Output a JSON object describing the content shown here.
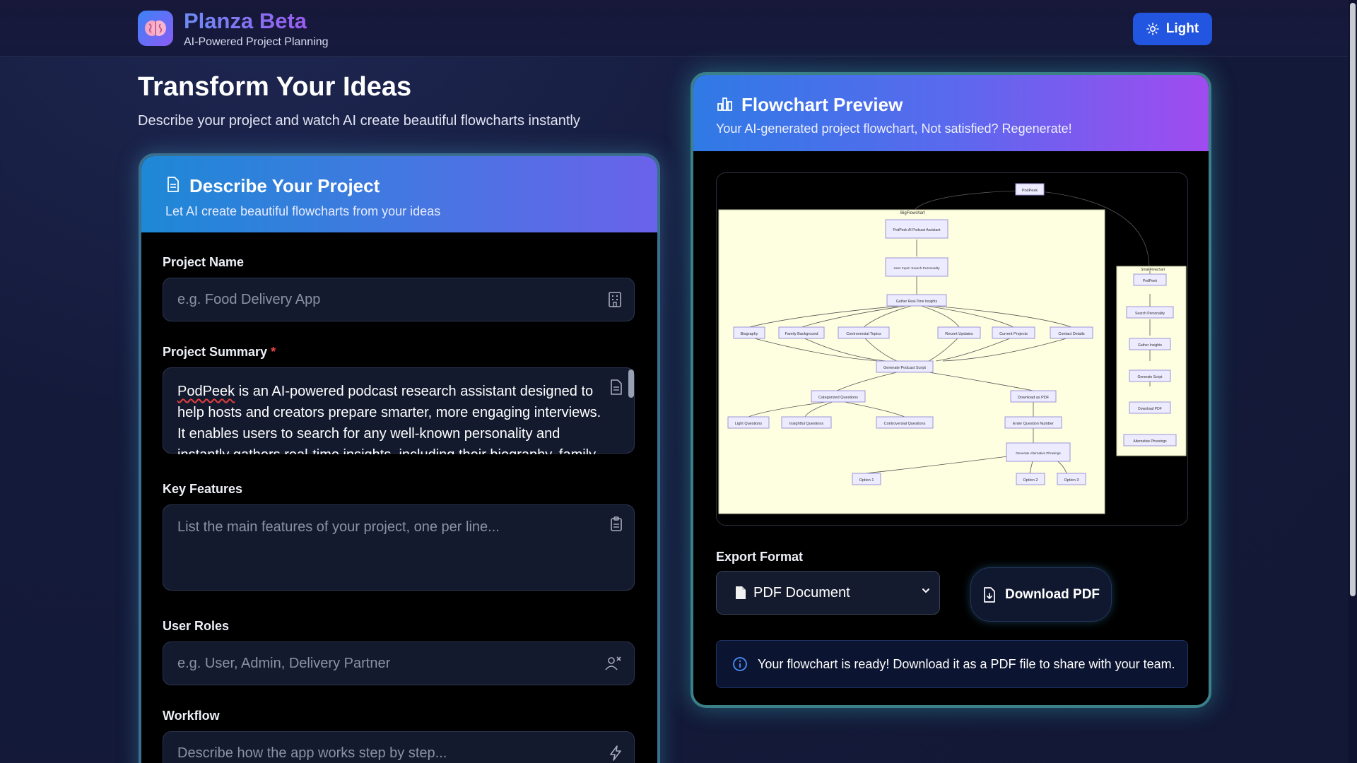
{
  "header": {
    "brand_title": "Planza Beta",
    "brand_subtitle": "AI-Powered Project Planning",
    "theme_toggle_label": "Light"
  },
  "hero": {
    "title": "Transform Your Ideas",
    "subtitle": "Describe your project and watch AI create beautiful flowcharts instantly"
  },
  "form_card": {
    "title": "Describe Your Project",
    "subtitle": "Let AI create beautiful flowcharts from your ideas",
    "fields": {
      "project_name": {
        "label": "Project Name",
        "placeholder": "e.g. Food Delivery App",
        "value": ""
      },
      "project_summary": {
        "label": "Project Summary",
        "required_mark": "*",
        "value_first_word": "PodPeek",
        "value_rest": " is an AI-powered podcast research assistant designed to help hosts and creators prepare smarter, more engaging interviews. It enables users to search for any well-known personality and instantly gathers real-time insights, including their biography, family"
      },
      "key_features": {
        "label": "Key Features",
        "placeholder": "List the main features of your project, one per line..."
      },
      "user_roles": {
        "label": "User Roles",
        "placeholder": "e.g. User, Admin, Delivery Partner"
      },
      "workflow": {
        "label": "Workflow",
        "placeholder": "Describe how the app works step by step..."
      }
    }
  },
  "preview_card": {
    "title": "Flowchart Preview",
    "subtitle": "Your AI-generated project flowchart, Not satisfied? Regenerate!",
    "flowchart": {
      "root": "PodPeek",
      "big_label": "BigFlowchart",
      "small_label": "SmallFlowchart",
      "big_nodes": {
        "assistant": "PodPeek AI Podcast Assistant",
        "input": "User Input: Search Personality",
        "gather": "Gather Real-Time Insights",
        "biography": "Biography",
        "family": "Family Background",
        "controversial": "Controversial Topics",
        "recent": "Recent Updates",
        "projects": "Current Projects",
        "contact": "Contact Details",
        "script": "Generate Podcast Script",
        "categorized": "Categorized Questions",
        "download": "Download as PDF",
        "light": "Light Questions",
        "insightful": "Insightful Questions",
        "controversial_q": "Controversial Questions",
        "enter_number": "Enter Question Number",
        "alternative": "Generate Alternative Phrasings",
        "option1": "Option 1",
        "option2": "Option 2",
        "option3": "Option 3"
      },
      "small_nodes": [
        "PodPeek",
        "Search Personality",
        "Gather Insights",
        "Generate Script",
        "Download PDF",
        "Alternative Phrasings"
      ]
    },
    "export_label": "Export Format",
    "export_value": "PDF Document",
    "download_label": "Download PDF",
    "info_message": "Your flowchart is ready! Download it as a PDF file to share with your team."
  },
  "colors": {
    "primary": "#2255e0",
    "accent_purple": "#8b5cf6",
    "required": "#ef4444",
    "flow_background": "#fefee0",
    "node_fill": "#ecebff"
  }
}
